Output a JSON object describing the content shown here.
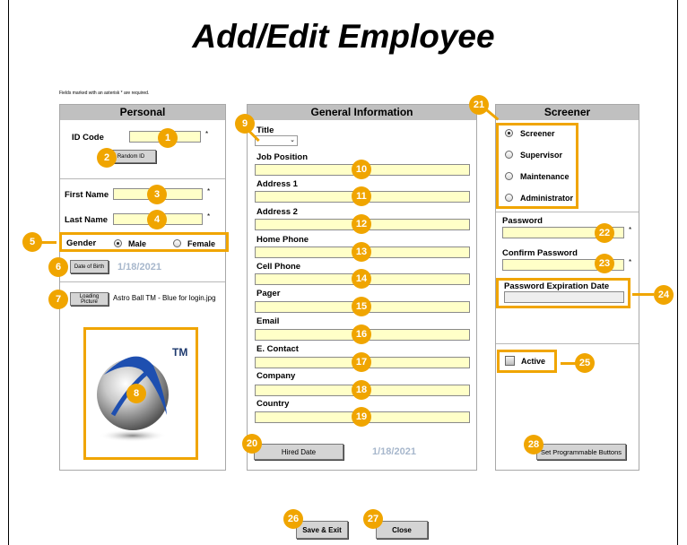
{
  "page_title": "Add/Edit Employee",
  "required_note": "Fields marked with an asterisk * are required.",
  "required_mark": "*",
  "personal": {
    "header": "Personal",
    "id_code_label": "ID Code",
    "random_id_button": "Random ID",
    "first_name_label": "First Name",
    "last_name_label": "Last Name",
    "gender_label": "Gender",
    "gender_options": [
      "Male",
      "Female"
    ],
    "gender_selected": "Male",
    "dob_button": "Date of Birth",
    "dob_value": "1/18/2021",
    "loading_picture_button": "Loading Picture",
    "picture_filename": "Astro Ball TM - Blue for login.jpg",
    "logo_tm": "TM"
  },
  "general": {
    "header": "General Information",
    "title_label": "Title",
    "job_position_label": "Job Position",
    "address1_label": "Address 1",
    "address2_label": "Address 2",
    "home_phone_label": "Home Phone",
    "cell_phone_label": "Cell Phone",
    "pager_label": "Pager",
    "email_label": "Email",
    "econtact_label": "E. Contact",
    "company_label": "Company",
    "country_label": "Country",
    "hired_date_button": "Hired Date",
    "hired_date_value": "1/18/2021"
  },
  "screener": {
    "header": "Screener",
    "roles": [
      "Screener",
      "Supervisor",
      "Maintenance",
      "Administrator"
    ],
    "role_selected": "Screener",
    "password_label": "Password",
    "confirm_password_label": "Confirm Password",
    "password_expiration_label": "Password Expiration Date",
    "active_label": "Active",
    "active_checked": false,
    "set_programmable_button": "Set Programmable Buttons"
  },
  "footer": {
    "save_exit_button": "Save & Exit",
    "close_button": "Close"
  },
  "callout_numbers": [
    "1",
    "2",
    "3",
    "4",
    "5",
    "6",
    "7",
    "8",
    "9",
    "10",
    "11",
    "12",
    "13",
    "14",
    "15",
    "16",
    "17",
    "18",
    "19",
    "20",
    "21",
    "22",
    "23",
    "24",
    "25",
    "26",
    "27",
    "28"
  ],
  "colors": {
    "callout": "#f0a500",
    "field_bg": "#ffffc8",
    "panel_header": "#c0c0c0",
    "date_text": "#a7b7cc"
  }
}
